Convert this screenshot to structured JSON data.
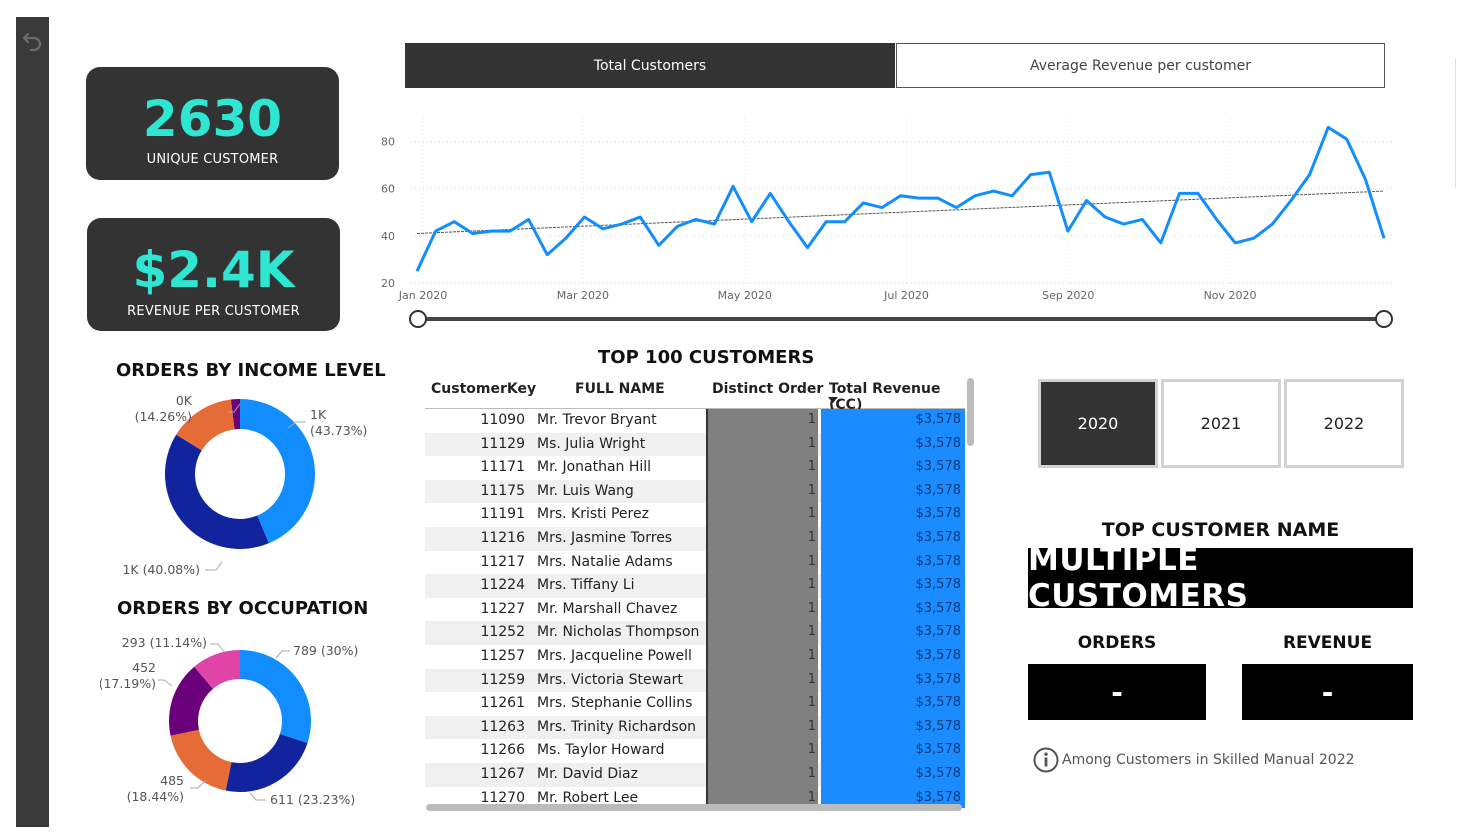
{
  "kpis": {
    "unique_customers": {
      "value": "2630",
      "label": "UNIQUE CUSTOMER"
    },
    "revenue_per_customer": {
      "value": "$2.4K",
      "label": "REVENUE PER CUSTOMER"
    }
  },
  "tabs": [
    {
      "label": "Total Customers",
      "active": true
    },
    {
      "label": "Average Revenue per customer",
      "active": false
    }
  ],
  "chart_data": [
    {
      "type": "line",
      "title": "",
      "xlabel": "",
      "ylabel": "",
      "x_tick_labels": [
        "Jan 2020",
        "Mar 2020",
        "May 2020",
        "Jul 2020",
        "Sep 2020",
        "Nov 2020"
      ],
      "y_ticks": [
        20,
        40,
        60,
        80
      ],
      "ylim": [
        20,
        90
      ],
      "grid": true,
      "series": [
        {
          "values": [
            25,
            42,
            46,
            41,
            42,
            42,
            47,
            32,
            39,
            48,
            43,
            45,
            48,
            36,
            44,
            47,
            45,
            61,
            46,
            58,
            46,
            35,
            46,
            46,
            54,
            52,
            57,
            56,
            56,
            52,
            57,
            59,
            57,
            66,
            67,
            42,
            55,
            48,
            45,
            47,
            37,
            58,
            58,
            47,
            37,
            39,
            45,
            55,
            66,
            86,
            81,
            64,
            39
          ]
        }
      ],
      "trend_line": {
        "start": 41,
        "end": 59
      }
    },
    {
      "type": "pie",
      "title": "ORDERS BY INCOME LEVEL",
      "slices": [
        {
          "label": "1K",
          "pct_label": "(43.73%)",
          "value": 43.73,
          "color": "#118dff"
        },
        {
          "label": "1K",
          "pct_label": "(40.08%)",
          "value": 40.08,
          "color": "#12239e"
        },
        {
          "label": "0K",
          "pct_label": "(14.26%)",
          "value": 14.26,
          "color": "#e66c37"
        },
        {
          "label": "",
          "pct_label": "",
          "value": 1.93,
          "color": "#6b007b"
        }
      ]
    },
    {
      "type": "pie",
      "title": "ORDERS BY OCCUPATION",
      "slices": [
        {
          "label": "789",
          "pct_label": "(30%)",
          "value": 789,
          "color": "#118dff"
        },
        {
          "label": "611",
          "pct_label": "(23.23%)",
          "value": 611,
          "color": "#12239e"
        },
        {
          "label": "485",
          "pct_label": "(18.44%)",
          "value": 485,
          "color": "#e66c37"
        },
        {
          "label": "452",
          "pct_label": "(17.19%)",
          "value": 452,
          "color": "#6b007b"
        },
        {
          "label": "293",
          "pct_label": "(11.14%)",
          "value": 293,
          "color": "#e044a7"
        }
      ]
    }
  ],
  "table": {
    "title": "TOP 100 CUSTOMERS",
    "headers": [
      "CustomerKey",
      "FULL NAME",
      "Distinct Order",
      "Total Revenue (CC)"
    ],
    "rows": [
      [
        "11090",
        "Mr. Trevor Bryant",
        "1",
        "$3,578"
      ],
      [
        "11129",
        "Ms. Julia Wright",
        "1",
        "$3,578"
      ],
      [
        "11171",
        "Mr. Jonathan Hill",
        "1",
        "$3,578"
      ],
      [
        "11175",
        "Mr. Luis Wang",
        "1",
        "$3,578"
      ],
      [
        "11191",
        "Mrs. Kristi Perez",
        "1",
        "$3,578"
      ],
      [
        "11216",
        "Mrs. Jasmine Torres",
        "1",
        "$3,578"
      ],
      [
        "11217",
        "Mrs. Natalie Adams",
        "1",
        "$3,578"
      ],
      [
        "11224",
        "Mrs. Tiffany Li",
        "1",
        "$3,578"
      ],
      [
        "11227",
        "Mr. Marshall Chavez",
        "1",
        "$3,578"
      ],
      [
        "11252",
        "Mr. Nicholas Thompson",
        "1",
        "$3,578"
      ],
      [
        "11257",
        "Mrs. Jacqueline Powell",
        "1",
        "$3,578"
      ],
      [
        "11259",
        "Mrs. Victoria Stewart",
        "1",
        "$3,578"
      ],
      [
        "11261",
        "Mrs. Stephanie Collins",
        "1",
        "$3,578"
      ],
      [
        "11263",
        "Mrs. Trinity Richardson",
        "1",
        "$3,578"
      ],
      [
        "11266",
        "Ms. Taylor Howard",
        "1",
        "$3,578"
      ],
      [
        "11267",
        "Mr. David Diaz",
        "1",
        "$3,578"
      ],
      [
        "11270",
        "Mr. Robert Lee",
        "1",
        "$3,578"
      ]
    ]
  },
  "years": [
    {
      "label": "2020",
      "active": true
    },
    {
      "label": "2021",
      "active": false
    },
    {
      "label": "2022",
      "active": false
    }
  ],
  "top_customer": {
    "title": "TOP CUSTOMER NAME",
    "value": "MULTIPLE CUSTOMERS",
    "orders_label": "ORDERS",
    "orders_value": "-",
    "revenue_label": "REVENUE",
    "revenue_value": "-",
    "note": "Among Customers in Skilled Manual 2022"
  }
}
